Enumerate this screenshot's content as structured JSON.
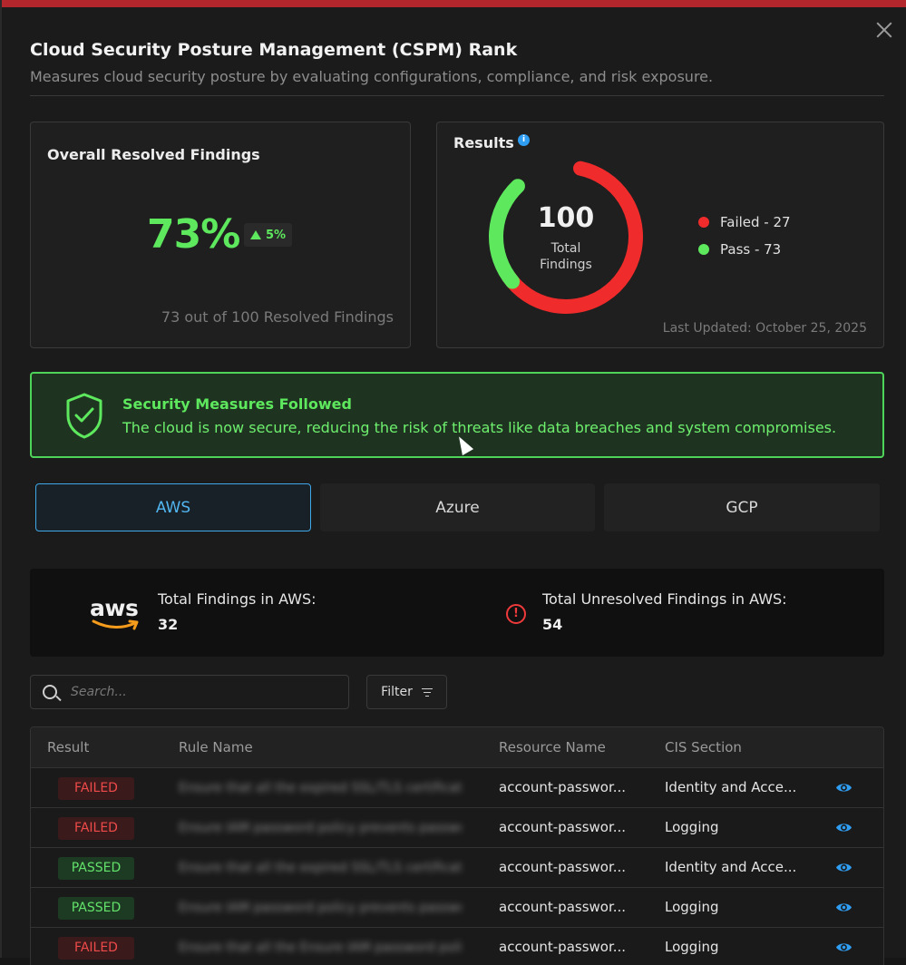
{
  "modal": {
    "title": "Cloud Security Posture Management (CSPM) Rank",
    "subtitle": "Measures cloud security posture by evaluating configurations, compliance, and risk exposure."
  },
  "overall": {
    "label": "Overall Resolved Findings",
    "percent_text": "73%",
    "percent_value": 73,
    "delta_text": "5%",
    "note": "73 out of 100 Resolved Findings"
  },
  "results": {
    "label": "Results",
    "total": "100",
    "total_caption_line1": "Total",
    "total_caption_line2": "Findings",
    "legend": [
      {
        "label": "Failed - 27",
        "color": "#f02b2b",
        "value": 27
      },
      {
        "label": "Pass - 73",
        "color": "#5ee85e",
        "value": 73
      }
    ],
    "last_updated": "Last Updated:  October 25, 2025"
  },
  "banner": {
    "title": "Security Measures Followed",
    "text": "The cloud is now secure, reducing the risk of threats like data breaches and system compromises."
  },
  "tabs": [
    {
      "label": "AWS",
      "active": true
    },
    {
      "label": "Azure",
      "active": false
    },
    {
      "label": "GCP",
      "active": false
    }
  ],
  "summary": {
    "aws_logo_text": "aws",
    "total_label": "Total Findings in AWS:",
    "total_value": "32",
    "unresolved_label": "Total Unresolved Findings in AWS:",
    "unresolved_value": "54"
  },
  "search": {
    "placeholder": "Search..."
  },
  "filter": {
    "label": "Filter"
  },
  "table": {
    "headers": [
      "Result",
      "Rule Name",
      "Resource Name",
      "CIS Section"
    ],
    "rows": [
      {
        "result": "FAILED",
        "rule": "Ensure that all the expired SSL/TLS certificates are removed",
        "resource": "account-passwor...",
        "section": "Identity and Acce..."
      },
      {
        "result": "FAILED",
        "rule": "Ensure IAM password policy prevents password reuse",
        "resource": "account-passwor...",
        "section": "Logging"
      },
      {
        "result": "PASSED",
        "rule": "Ensure that all the expired SSL/TLS certificates are removed",
        "resource": "account-passwor...",
        "section": "Identity and Acce..."
      },
      {
        "result": "PASSED",
        "rule": "Ensure IAM password policy prevents password reuse",
        "resource": "account-passwor...",
        "section": "Logging"
      },
      {
        "result": "FAILED",
        "rule": "Ensure that all the Ensure IAM password policy",
        "resource": "account-passwor...",
        "section": "Logging"
      }
    ]
  }
}
